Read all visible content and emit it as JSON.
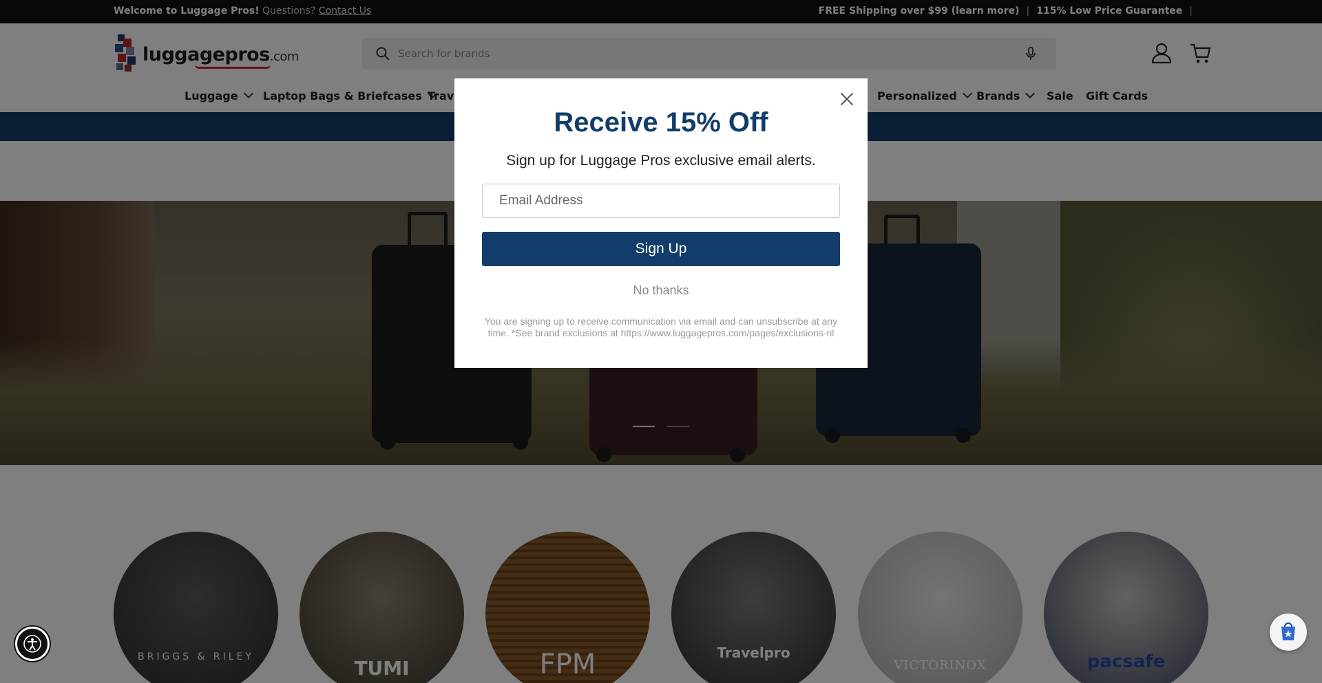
{
  "topbar": {
    "welcome": "Welcome to Luggage Pros",
    "excl": "!",
    "questions": " Questions? ",
    "contact": "Contact Us",
    "shipping": "FREE Shipping over $99 (learn more)",
    "sep": "|",
    "guarantee": "115% Low Price Guarantee"
  },
  "header": {
    "logo_word": "luggagepros",
    "logo_suffix": ".com",
    "search_placeholder": "Search for brands"
  },
  "nav": {
    "items": [
      "Luggage",
      "Laptop Bags & Briefcases",
      "Trave",
      "Personalized",
      "Brands",
      "Sale",
      "Gift Cards"
    ]
  },
  "brands": {
    "items": [
      "BRIGGS & RILEY",
      "TUMI",
      "FPM",
      "Travelpro",
      "VICTORINOX",
      "pacsafe"
    ]
  },
  "modal": {
    "title": "Receive 15% Off",
    "subtitle": "Sign up for Luggage Pros exclusive email alerts.",
    "email_placeholder": "Email Address",
    "signup": "Sign Up",
    "no_thanks": "No thanks",
    "fine_print": "You are signing up to receive communication via email and can unsubscribe at any time. *See brand exclusions at https://www.luggagepros.com/pages/exclusions-nl"
  },
  "colors": {
    "brand_blue": "#123d6a",
    "topbar_bg": "#111111",
    "accent_red": "#c1272d"
  },
  "icons": [
    "search-icon",
    "microphone-icon",
    "account-icon",
    "cart-icon",
    "close-icon",
    "accessibility-icon",
    "chat-icon"
  ]
}
